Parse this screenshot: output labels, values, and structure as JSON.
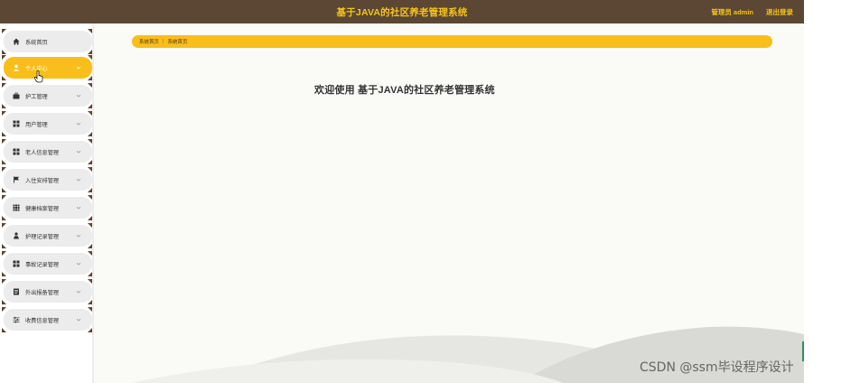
{
  "header": {
    "title": "基于JAVA的社区养老管理系统",
    "user": "管理员 admin",
    "logout": "退出登录"
  },
  "sidebar": {
    "items": [
      {
        "label": "系统首页",
        "icon": "home-icon",
        "active": false
      },
      {
        "label": "个人中心",
        "icon": "user-icon",
        "active": true
      },
      {
        "label": "护工管理",
        "icon": "briefcase-icon",
        "active": false
      },
      {
        "label": "用户管理",
        "icon": "grid-icon",
        "active": false
      },
      {
        "label": "老人信息管理",
        "icon": "grid-icon",
        "active": false
      },
      {
        "label": "入住安排管理",
        "icon": "flag-icon",
        "active": false
      },
      {
        "label": "健康档案管理",
        "icon": "table-icon",
        "active": false
      },
      {
        "label": "护理记录管理",
        "icon": "person-icon",
        "active": false
      },
      {
        "label": "事故记录管理",
        "icon": "grid-icon",
        "active": false
      },
      {
        "label": "外出报备管理",
        "icon": "document-icon",
        "active": false
      },
      {
        "label": "收费信息管理",
        "icon": "sliders-icon",
        "active": false
      }
    ]
  },
  "breadcrumb": {
    "items": [
      "系统首页",
      "系统首页"
    ],
    "separator": "|"
  },
  "main": {
    "welcome": "欢迎使用 基于JAVA的社区养老管理系统"
  },
  "watermark": "CSDN @ssm毕设程序设计",
  "colors": {
    "header_bg": "#5c4734",
    "accent": "#f8bf1a",
    "menu_bg": "#ececec",
    "title_text": "#f5c518"
  }
}
